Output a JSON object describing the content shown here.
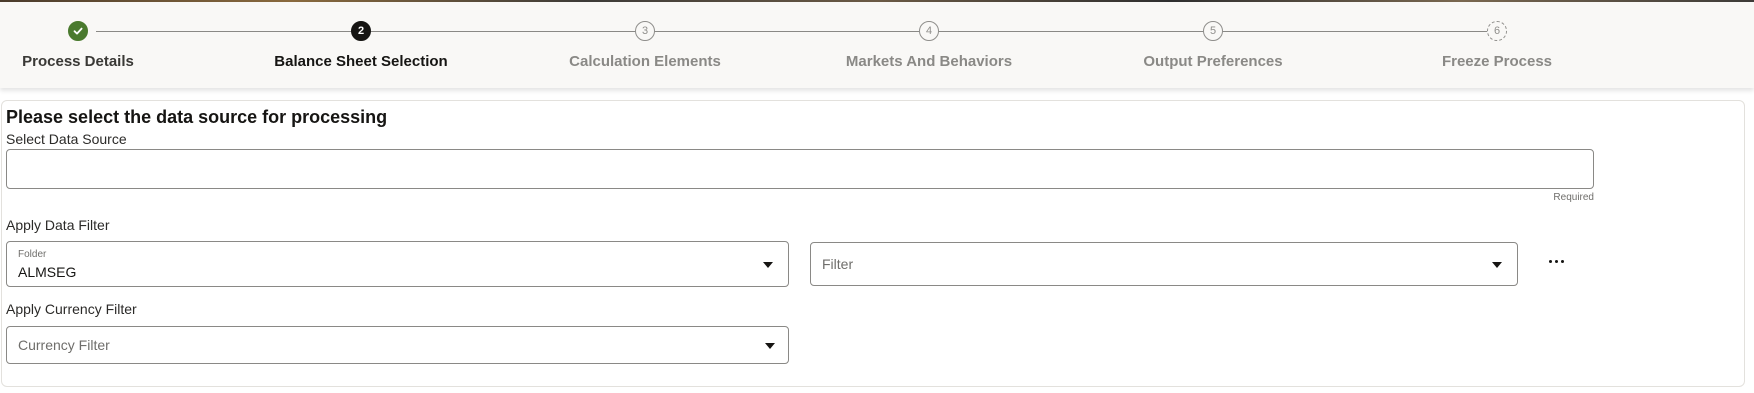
{
  "train": {
    "steps": [
      {
        "number": "",
        "label": "Process Details",
        "state": "visited"
      },
      {
        "number": "2",
        "label": "Balance Sheet Selection",
        "state": "current"
      },
      {
        "number": "3",
        "label": "Calculation Elements",
        "state": "future"
      },
      {
        "number": "4",
        "label": "Markets And Behaviors",
        "state": "future"
      },
      {
        "number": "5",
        "label": "Output Preferences",
        "state": "future"
      },
      {
        "number": "6",
        "label": "Freeze Process",
        "state": "future"
      }
    ]
  },
  "form": {
    "heading": "Please select the data source for processing",
    "data_source": {
      "label": "Select Data Source",
      "value": "",
      "helper": "Required"
    },
    "data_filter": {
      "section_label": "Apply Data Filter",
      "folder": {
        "label": "Folder",
        "value": "ALMSEG"
      },
      "filter": {
        "placeholder": "Filter"
      },
      "more_icon": "more-horizontal-icon"
    },
    "currency_filter": {
      "section_label": "Apply Currency Filter",
      "placeholder": "Currency Filter"
    }
  },
  "colors": {
    "visited": "#4a7a2e",
    "current": "#161513",
    "future": "#8f8e8b",
    "train_background": "#f9f8f6"
  }
}
